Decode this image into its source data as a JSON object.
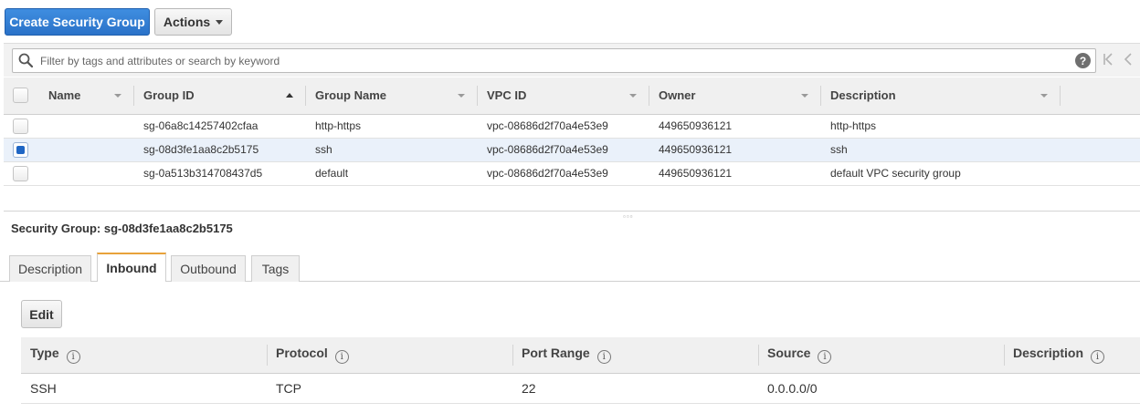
{
  "toolbar": {
    "create_label": "Create Security Group",
    "actions_label": "Actions"
  },
  "filter": {
    "placeholder": "Filter by tags and attributes or search by keyword",
    "help_glyph": "?"
  },
  "groups_table": {
    "columns": [
      "Name",
      "Group ID",
      "Group Name",
      "VPC ID",
      "Owner",
      "Description"
    ],
    "sorted_column": "Group ID",
    "rows": [
      {
        "name": "",
        "group_id": "sg-06a8c14257402cfaa",
        "group_name": "http-https",
        "vpc_id": "vpc-08686d2f70a4e53e9",
        "owner": "449650936121",
        "description": "http-https",
        "selected": false
      },
      {
        "name": "",
        "group_id": "sg-08d3fe1aa8c2b5175",
        "group_name": "ssh",
        "vpc_id": "vpc-08686d2f70a4e53e9",
        "owner": "449650936121",
        "description": "ssh",
        "selected": true
      },
      {
        "name": "",
        "group_id": "sg-0a513b314708437d5",
        "group_name": "default",
        "vpc_id": "vpc-08686d2f70a4e53e9",
        "owner": "449650936121",
        "description": "default VPC security group",
        "selected": false
      }
    ]
  },
  "detail": {
    "title": "Security Group: sg-08d3fe1aa8c2b5175",
    "tabs": [
      {
        "label": "Description",
        "active": false
      },
      {
        "label": "Inbound",
        "active": true
      },
      {
        "label": "Outbound",
        "active": false
      },
      {
        "label": "Tags",
        "active": false
      }
    ],
    "edit_label": "Edit",
    "rules": {
      "columns": [
        "Type",
        "Protocol",
        "Port Range",
        "Source",
        "Description"
      ],
      "info_glyph": "i",
      "rows": [
        {
          "type": "SSH",
          "protocol": "TCP",
          "port_range": "22",
          "source": "0.0.0.0/0",
          "description": ""
        }
      ]
    }
  },
  "colors": {
    "primary_button": "#2a72c8",
    "active_tab_accent": "#e8a23a",
    "selected_row": "#eaf1fa",
    "checkbox_fill": "#1f66c4"
  }
}
